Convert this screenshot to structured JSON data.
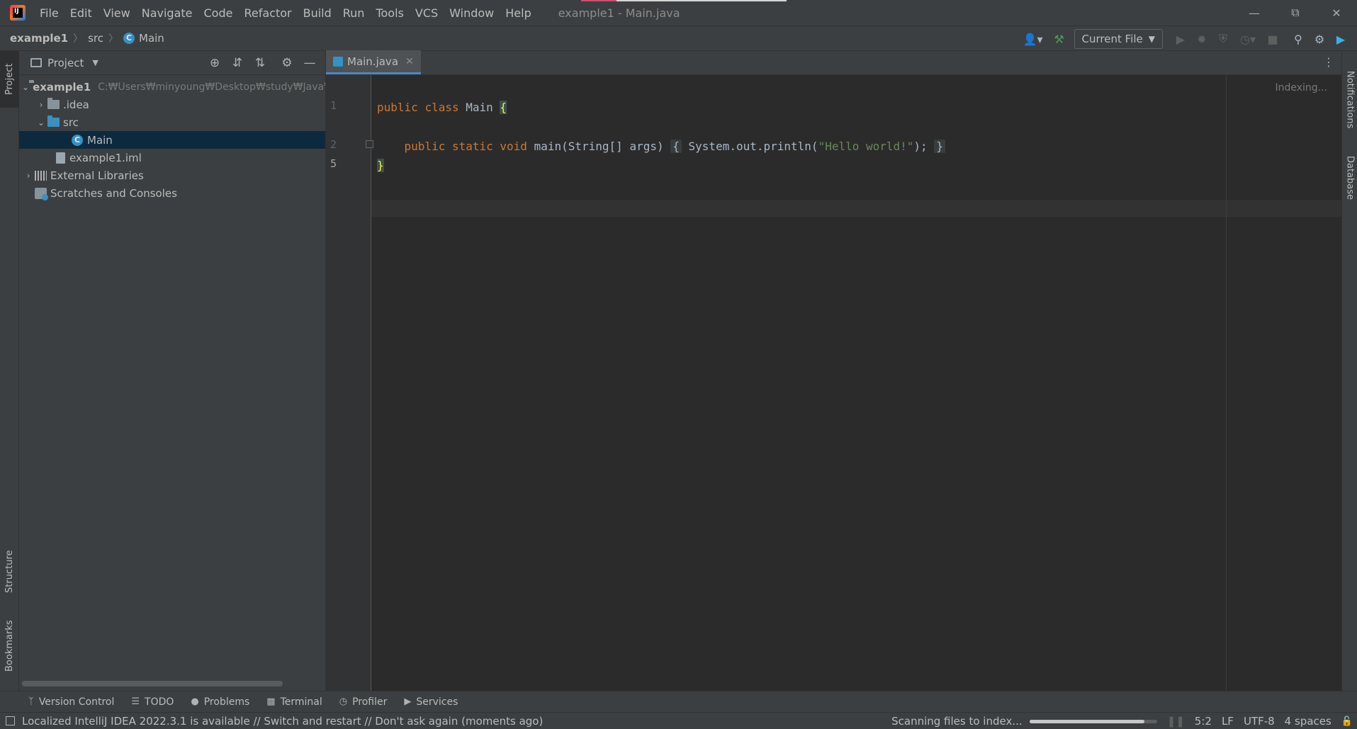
{
  "titlebar": {
    "menu": [
      "File",
      "Edit",
      "View",
      "Navigate",
      "Code",
      "Refactor",
      "Build",
      "Run",
      "Tools",
      "VCS",
      "Window",
      "Help"
    ],
    "window_title": "example1 - Main.java"
  },
  "navbar": {
    "breadcrumbs": [
      "example1",
      "src",
      "Main"
    ],
    "run_config": "Current File"
  },
  "left_stripe": {
    "project": "Project",
    "structure": "Structure",
    "bookmarks": "Bookmarks"
  },
  "right_stripe": {
    "notifications": "Notifications",
    "database": "Database"
  },
  "project_panel": {
    "title": "Project",
    "tree": [
      {
        "label": "example1",
        "path": "C:₩Users₩minyoung₩Desktop₩study₩Java₩"
      },
      {
        "label": ".idea"
      },
      {
        "label": "src"
      },
      {
        "label": "Main"
      },
      {
        "label": "example1.iml"
      },
      {
        "label": "External Libraries"
      },
      {
        "label": "Scratches and Consoles"
      }
    ]
  },
  "editor": {
    "tab": "Main.java",
    "status": "Indexing...",
    "line_numbers": [
      "1",
      "2",
      "5"
    ],
    "code": {
      "l1_kw1": "public",
      "l1_kw2": "class",
      "l1_name": "Main",
      "l1_brace": "{",
      "l2_kw1": "public",
      "l2_kw2": "static",
      "l2_kw3": "void",
      "l2_sig": "main(String[] args)",
      "l2_open": "{",
      "l2_call": "System.out.println(",
      "l2_str": "\"Hello world!\"",
      "l2_end": ");",
      "l2_close": "}",
      "l3_brace": "}"
    }
  },
  "bottom_tools": [
    "Version Control",
    "TODO",
    "Problems",
    "Terminal",
    "Profiler",
    "Services"
  ],
  "statusbar": {
    "message": "Localized IntelliJ IDEA 2022.3.1 is available // Switch and restart // Don't ask again (moments ago)",
    "task": "Scanning files to index...",
    "progress": 0.9,
    "position": "5:2",
    "line_sep": "LF",
    "encoding": "UTF-8",
    "indent": "4 spaces"
  },
  "colors": {
    "keyword": "#cc7832",
    "string": "#6a8759",
    "text": "#a9b7c6",
    "selection": "#0d293e",
    "accent": "#4a88c7"
  }
}
